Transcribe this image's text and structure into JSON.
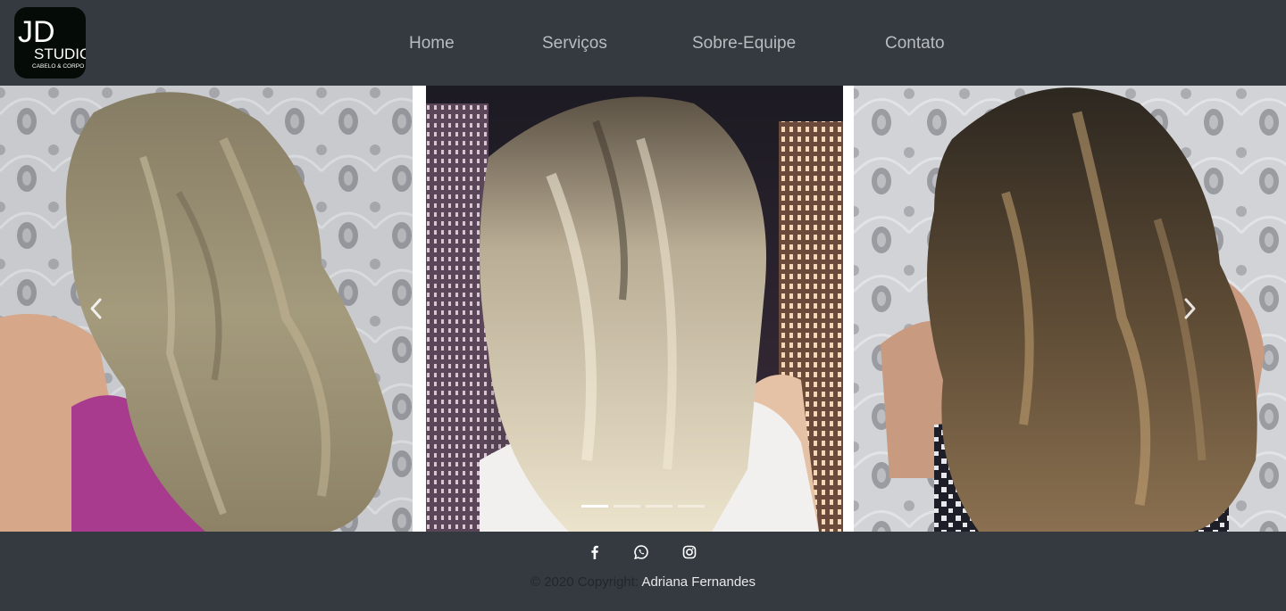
{
  "brand": {
    "logo_letters": "JD",
    "logo_word": "STUDIO",
    "logo_tagline": "CABELO & CORPO"
  },
  "nav": {
    "items": [
      "Home",
      "Serviços",
      "Sobre-Equipe",
      "Contato"
    ]
  },
  "carousel": {
    "slide_count": 4,
    "active_index": 0,
    "prev_icon": "chevron-left-icon",
    "next_icon": "chevron-right-icon"
  },
  "footer": {
    "social_icons": [
      "facebook-icon",
      "whatsapp-icon",
      "instagram-icon"
    ],
    "copyright": "© 2020 Copyright:",
    "author": "Adriana Fernandes"
  },
  "colors": {
    "navbar_bg": "#343a40",
    "nav_text": "#b9bcbf",
    "logo_bg": "#050b06"
  }
}
